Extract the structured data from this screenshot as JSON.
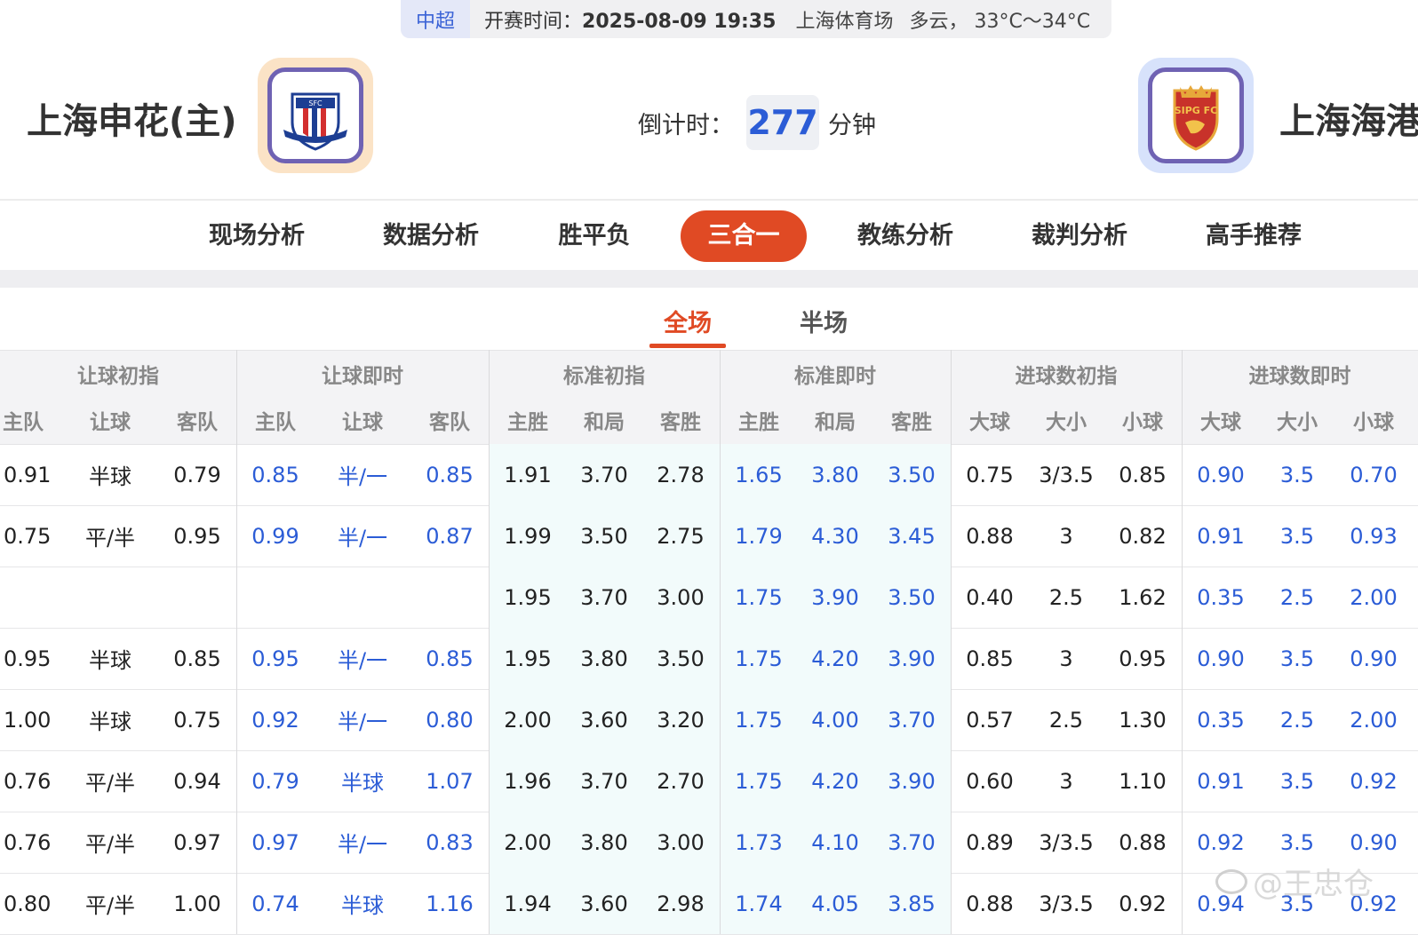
{
  "info": {
    "league": "中超",
    "kickoff_label": "开赛时间：",
    "kickoff_time": "2025-08-09 19:35",
    "venue": "上海体育场",
    "weather": "多云， 33°C～34°C"
  },
  "home": {
    "name": "上海申花(主)",
    "logo_text": "SFC"
  },
  "away": {
    "name": "上海海港",
    "logo_text": "SIPG FC"
  },
  "countdown": {
    "label": "倒计时：",
    "value": "277",
    "unit": "分钟"
  },
  "tabs": [
    "现场分析",
    "数据分析",
    "胜平负",
    "三合一",
    "教练分析",
    "裁判分析",
    "高手推荐"
  ],
  "active_tab": "三合一",
  "subtabs": [
    "全场",
    "半场"
  ],
  "active_subtab": "全场",
  "table": {
    "groups": [
      "让球初指",
      "让球即时",
      "标准初指",
      "标准即时",
      "进球数初指",
      "进球数即时"
    ],
    "columns": [
      "主队",
      "让球",
      "客队",
      "主队",
      "让球",
      "客队",
      "主胜",
      "和局",
      "客胜",
      "主胜",
      "和局",
      "客胜",
      "大球",
      "大小",
      "小球",
      "大球",
      "大小",
      "小球"
    ],
    "rows": [
      [
        "0.91",
        "半球",
        "0.79",
        "0.85",
        "半/一",
        "0.85",
        "1.91",
        "3.70",
        "2.78",
        "1.65",
        "3.80",
        "3.50",
        "0.75",
        "3/3.5",
        "0.85",
        "0.90",
        "3.5",
        "0.70"
      ],
      [
        "0.75",
        "平/半",
        "0.95",
        "0.99",
        "半/一",
        "0.87",
        "1.99",
        "3.50",
        "2.75",
        "1.79",
        "4.30",
        "3.45",
        "0.88",
        "3",
        "0.82",
        "0.91",
        "3.5",
        "0.93"
      ],
      [
        "",
        "",
        "",
        "",
        "",
        "",
        "1.95",
        "3.70",
        "3.00",
        "1.75",
        "3.90",
        "3.50",
        "0.40",
        "2.5",
        "1.62",
        "0.35",
        "2.5",
        "2.00"
      ],
      [
        "0.95",
        "半球",
        "0.85",
        "0.95",
        "半/一",
        "0.85",
        "1.95",
        "3.80",
        "3.50",
        "1.75",
        "4.20",
        "3.90",
        "0.85",
        "3",
        "0.95",
        "0.90",
        "3.5",
        "0.90"
      ],
      [
        "1.00",
        "半球",
        "0.75",
        "0.92",
        "半/一",
        "0.80",
        "2.00",
        "3.60",
        "3.20",
        "1.75",
        "4.00",
        "3.70",
        "0.57",
        "2.5",
        "1.30",
        "0.35",
        "2.5",
        "2.00"
      ],
      [
        "0.76",
        "平/半",
        "0.94",
        "0.79",
        "半球",
        "1.07",
        "1.96",
        "3.70",
        "2.70",
        "1.75",
        "4.20",
        "3.90",
        "0.60",
        "3",
        "1.10",
        "0.91",
        "3.5",
        "0.92"
      ],
      [
        "0.76",
        "平/半",
        "0.97",
        "0.97",
        "半/一",
        "0.83",
        "2.00",
        "3.80",
        "3.00",
        "1.73",
        "4.10",
        "3.70",
        "0.89",
        "3/3.5",
        "0.88",
        "0.92",
        "3.5",
        "0.90"
      ],
      [
        "0.80",
        "平/半",
        "1.00",
        "0.74",
        "半球",
        "1.16",
        "1.94",
        "3.60",
        "2.98",
        "1.74",
        "4.05",
        "3.85",
        "0.88",
        "3/3.5",
        "0.92",
        "0.94",
        "3.5",
        "0.92"
      ]
    ]
  },
  "watermark": "@王忠仓",
  "colors": {
    "accent": "#e04a24",
    "blue": "#2b5cd6"
  }
}
